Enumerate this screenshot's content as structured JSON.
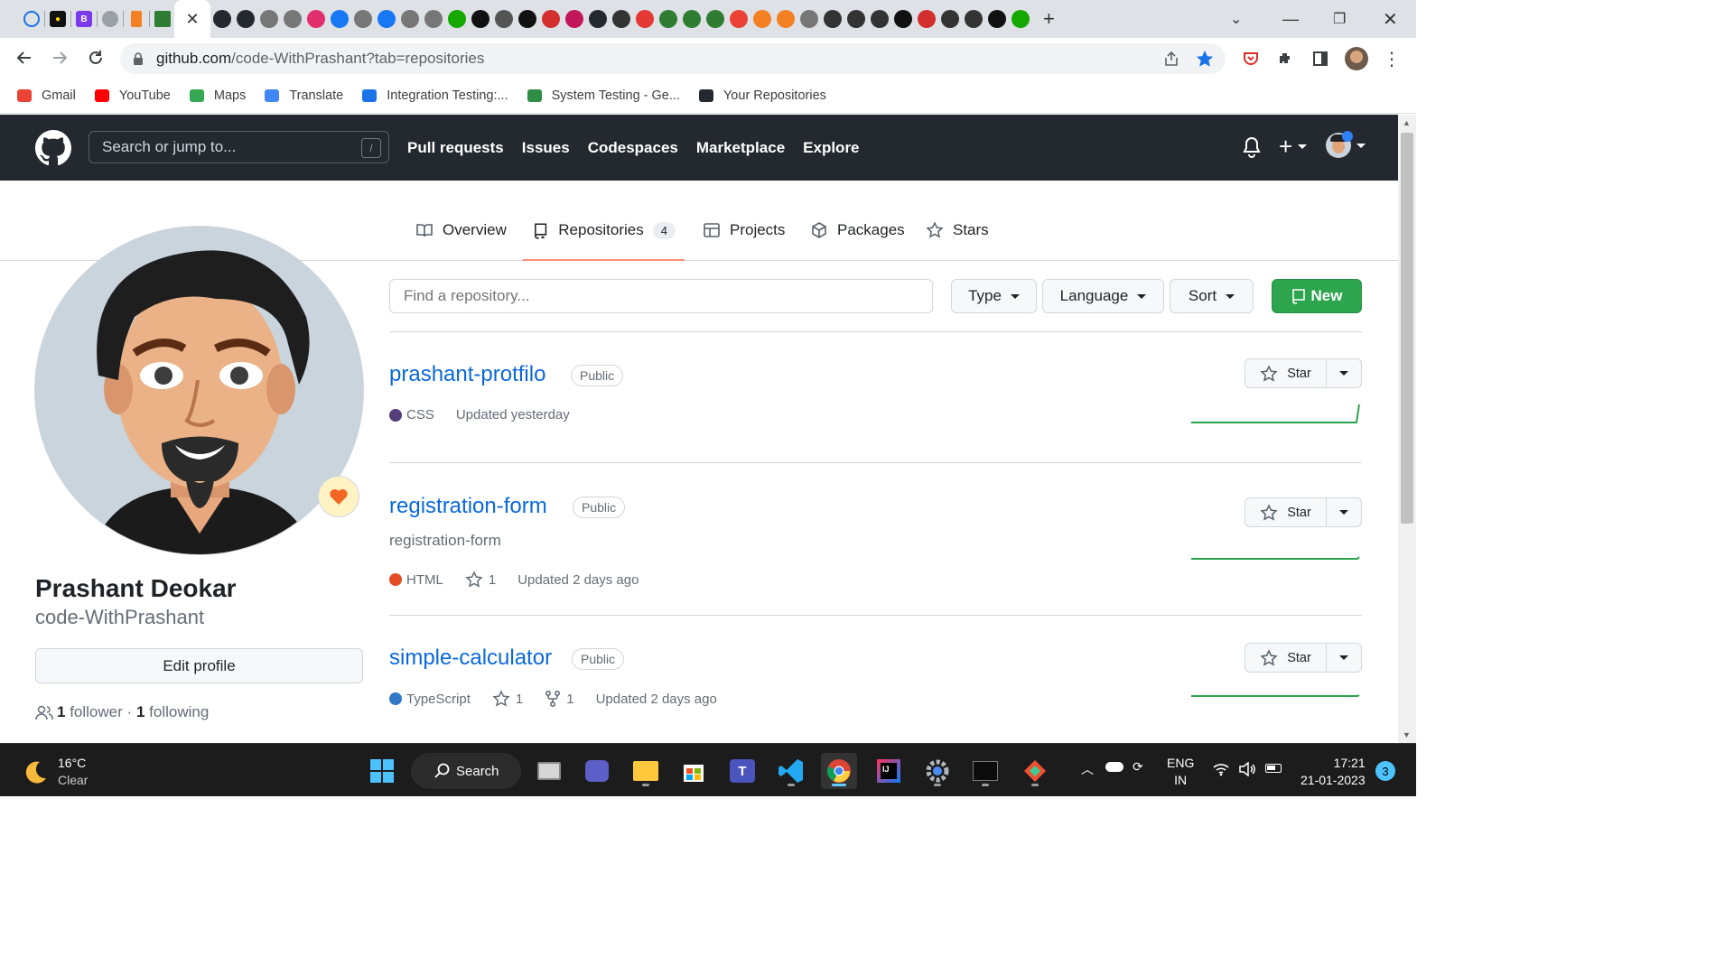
{
  "browser": {
    "url_host": "github.com",
    "url_path": "/code-WithPrashant?tab=repositories",
    "tabs": [
      {
        "icon": "circle-tab-icon",
        "color": "#1a73e8"
      },
      {
        "icon": "bulb-tab-icon",
        "color": "#111111"
      },
      {
        "icon": "b-tab-icon",
        "color": "#7c3aed",
        "letter": "B"
      },
      {
        "icon": "globe-tab-icon",
        "color": "#5f6368"
      },
      {
        "icon": "stack-tab-icon",
        "color": "#f48024"
      },
      {
        "icon": "site-tab-icon",
        "color": "#2e7d32"
      }
    ],
    "active_tab_close": "✕",
    "bookmarks": [
      {
        "label": "Gmail",
        "icon": "gmail-icon",
        "color": "#ea4335"
      },
      {
        "label": "YouTube",
        "icon": "youtube-icon",
        "color": "#ff0000"
      },
      {
        "label": "Maps",
        "icon": "maps-icon",
        "color": "#34a853"
      },
      {
        "label": "Translate",
        "icon": "translate-icon",
        "color": "#4285f4"
      },
      {
        "label": "Integration Testing:...",
        "icon": "integration-icon",
        "color": "#1a73e8"
      },
      {
        "label": "System Testing - Ge...",
        "icon": "gfg-icon",
        "color": "#2f8d46"
      },
      {
        "label": "Your Repositories",
        "icon": "github-icon",
        "color": "#24292f"
      }
    ]
  },
  "github": {
    "search_placeholder": "Search or jump to...",
    "search_shortcut": "/",
    "nav": [
      "Pull requests",
      "Issues",
      "Codespaces",
      "Marketplace",
      "Explore"
    ],
    "profile_tabs": [
      {
        "label": "Overview",
        "icon": "book-icon"
      },
      {
        "label": "Repositories",
        "icon": "repo-icon",
        "count": "4",
        "selected": true
      },
      {
        "label": "Projects",
        "icon": "table-icon"
      },
      {
        "label": "Packages",
        "icon": "package-icon"
      },
      {
        "label": "Stars",
        "icon": "star-icon"
      }
    ]
  },
  "profile": {
    "name": "Prashant Deokar",
    "login": "code-WithPrashant",
    "edit_label": "Edit profile",
    "followers_count": "1",
    "followers_label": "follower",
    "separator": "·",
    "following_count": "1",
    "following_label": "following"
  },
  "filters": {
    "find_placeholder": "Find a repository...",
    "type_label": "Type",
    "language_label": "Language",
    "sort_label": "Sort",
    "new_label": "New"
  },
  "repos": [
    {
      "name": "prashant-protfilo",
      "visibility": "Public",
      "description": "",
      "language": "CSS",
      "lang_color": "#563d7c",
      "stars": "",
      "forks": "",
      "updated": "Updated yesterday"
    },
    {
      "name": "registration-form",
      "visibility": "Public",
      "description": "registration-form",
      "language": "HTML",
      "lang_color": "#e34c26",
      "stars": "1",
      "forks": "",
      "updated": "Updated 2 days ago"
    },
    {
      "name": "simple-calculator",
      "visibility": "Public",
      "description": "",
      "language": "TypeScript",
      "lang_color": "#3178c6",
      "stars": "1",
      "forks": "1",
      "updated": "Updated 2 days ago"
    }
  ],
  "star_label": "Star",
  "taskbar": {
    "temp": "16°C",
    "condition": "Clear",
    "search_label": "Search",
    "lang_top": "ENG",
    "lang_bottom": "IN",
    "time": "17:21",
    "date": "21-01-2023",
    "notifications": "3"
  },
  "colors": {
    "accent_green": "#2da44e",
    "link_blue": "#0969da",
    "header_dark": "#24292f",
    "tab_underline": "#fd8c73"
  }
}
